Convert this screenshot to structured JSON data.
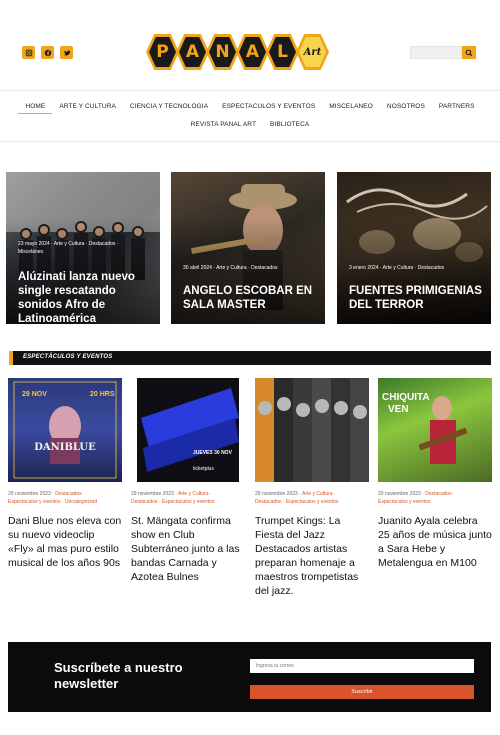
{
  "header": {
    "social": [
      {
        "icon": "instagram-icon"
      },
      {
        "icon": "facebook-icon"
      },
      {
        "icon": "twitter-icon"
      }
    ],
    "logo_letters": [
      "P",
      "A",
      "N",
      "A",
      "L",
      "Art"
    ],
    "search": {
      "placeholder": "",
      "icon": "search-icon"
    },
    "accent_color": "#f2a51a"
  },
  "nav": {
    "row1": [
      "HOME",
      "ARTE Y CULTURA",
      "CIENCIA Y TECNOLOGIA",
      "ESPECTACULOS Y EVENTOS",
      "MISCELANEO",
      "NOSOTROS",
      "PARTNERS"
    ],
    "row2": [
      "REVISTA PANAL ART",
      "BIBLIOTECA"
    ],
    "active": "HOME"
  },
  "featured": [
    {
      "meta1": "23 mayo 2024 · Arte y Cultura · Destacados ·",
      "meta2": "Misceláneo",
      "title": "Alúzinati lanza nuevo single rescatando sonidos Afro de Latinoamérica"
    },
    {
      "meta1": "30 abril 2024 · Arte y Cultura · Destacados",
      "meta2": "",
      "title": "ANGELO ESCOBAR EN SALA MASTER"
    },
    {
      "meta1": "3 enero 2024 · Arte y Cultura · Destacados",
      "meta2": "",
      "title": "FUENTES PRIMIGENIAS DEL TERROR"
    }
  ],
  "section": {
    "label": "ESPECTÁCULOS Y EVENTOS"
  },
  "cards": [
    {
      "date": "29 noviembre 2023",
      "cats1": "Destacados",
      "cats2": "Espectaculos y eventos · Uncategorized",
      "title": "Dani Blue nos eleva con su nuevo videoclip «Fly» al mas puro estilo musical de los años 90s",
      "poster_text": [
        "29 NOV",
        "20 HRS",
        "DANIBLUE"
      ]
    },
    {
      "date": "29 noviembre 2023",
      "cats1": "Arte y Cultura ·",
      "cats2": "Destacados · Espectaculos y eventos",
      "title": "St. Mängata confirma show en Club Subterráneo junto a las bandas Carnada y Azotea Bulnes",
      "poster_text": [
        "JUEVES 30 NOV",
        "ticketplus"
      ]
    },
    {
      "date": "29 noviembre 2023",
      "cats1": "Arte y Cultura ·",
      "cats2": "Destacados · Espectaculos y eventos",
      "title": "Trumpet Kings: La Fiesta del Jazz Destacados artistas preparan homenaje a maestros trompetistas del jazz.",
      "poster_text": []
    },
    {
      "date": "20 noviembre 2023",
      "cats1": "Destacados ·",
      "cats2": "Espectaculos y eventos",
      "title": "Juanito Ayala celebra 25 años de música junto a Sara Hebe y Metalengua en M100",
      "poster_text": [
        "CHIQUITA",
        "VEN"
      ]
    }
  ],
  "newsletter": {
    "title": "Suscríbete a nuestro newsletter",
    "email_placeholder": "Ingresa tu correo",
    "button_label": "Suscribir"
  }
}
